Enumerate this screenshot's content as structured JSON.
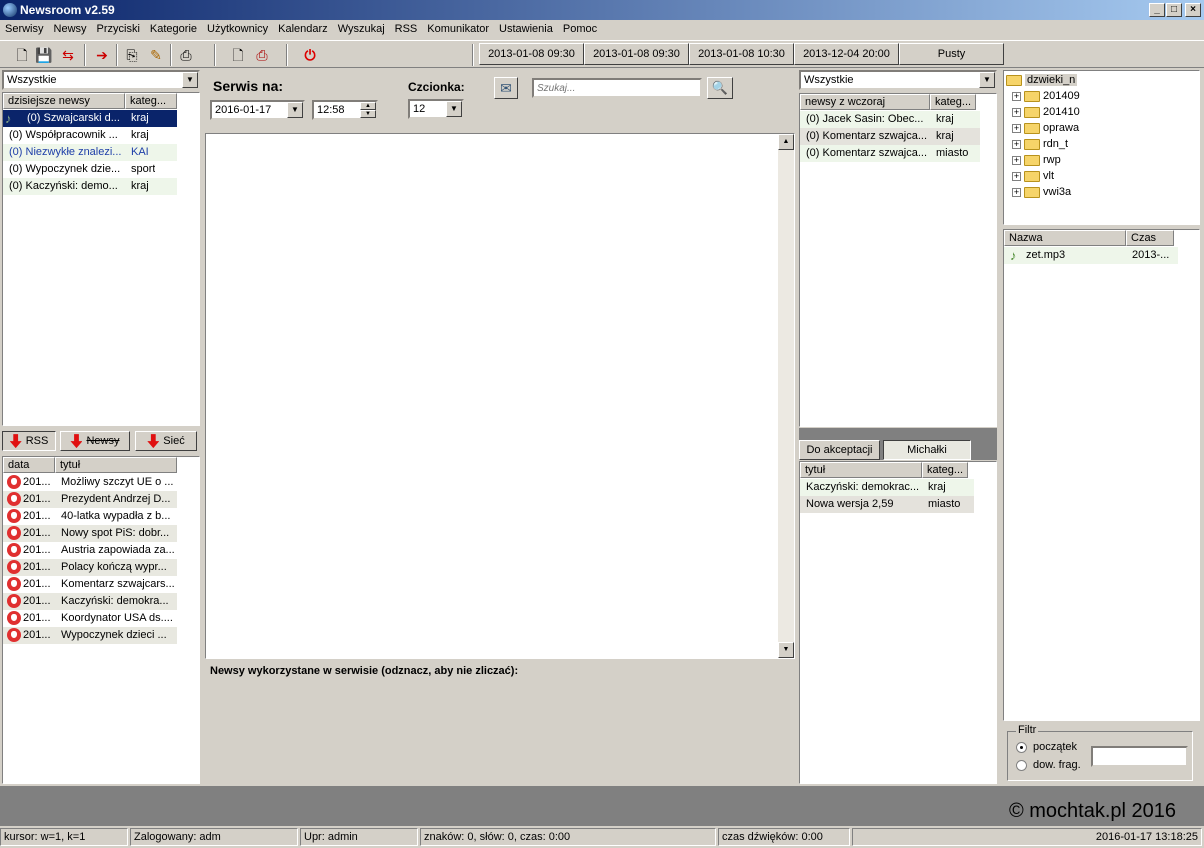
{
  "window": {
    "title": "Newsroom v2.59"
  },
  "menu": [
    "Serwisy",
    "Newsy",
    "Przyciski",
    "Kategorie",
    "Użytkownicy",
    "Kalendarz",
    "Wyszukaj",
    "RSS",
    "Komunikator",
    "Ustawienia",
    "Pomoc"
  ],
  "toolbar": {
    "icons": [
      "new-document-icon",
      "save-icon",
      "import-icon",
      "export-icon",
      "edit-icon",
      "pencil-icon",
      "print-icon",
      "new-file-icon",
      "printer-icon",
      "power-icon"
    ],
    "date_buttons": [
      "2013-01-08 09:30",
      "2013-01-08 09:30",
      "2013-01-08 10:30",
      "2013-12-04 20:00",
      "Pusty"
    ]
  },
  "left_panel": {
    "filter": "Wszystkie",
    "headers": [
      "dzisiejsze newsy",
      "kateg..."
    ],
    "rows": [
      {
        "title": "(0) Szwajcarski d...",
        "cat": "kraj"
      },
      {
        "title": "(0) Współpracownik ...",
        "cat": "kraj"
      },
      {
        "title": "(0) Niezwykłe znalezi...",
        "cat": "KAI"
      },
      {
        "title": "(0) Wypoczynek dzie...",
        "cat": "sport"
      },
      {
        "title": "(0) Kaczyński: demo...",
        "cat": "kraj"
      }
    ],
    "tabs": [
      "RSS",
      "Newsy",
      "Sieć"
    ],
    "rss_headers": [
      "data",
      "tytuł"
    ],
    "rss_rows": [
      {
        "date": "201...",
        "title": "Możliwy szczyt UE o ..."
      },
      {
        "date": "201...",
        "title": "Prezydent Andrzej D..."
      },
      {
        "date": "201...",
        "title": "40-latka wypadła z b..."
      },
      {
        "date": "201...",
        "title": "Nowy spot PiS: dobr..."
      },
      {
        "date": "201...",
        "title": "Austria zapowiada za..."
      },
      {
        "date": "201...",
        "title": "Polacy kończą wypr..."
      },
      {
        "date": "201...",
        "title": "Komentarz szwajcars..."
      },
      {
        "date": "201...",
        "title": "Kaczyński: demokra..."
      },
      {
        "date": "201...",
        "title": "Koordynator USA ds...."
      },
      {
        "date": "201...",
        "title": "Wypoczynek dzieci ..."
      }
    ]
  },
  "center": {
    "serwis_label": "Serwis na:",
    "date_value": "2016-01-17",
    "time_value": "12:58",
    "font_label": "Czcionka:",
    "font_value": "12",
    "search_placeholder": "Szukaj...",
    "footer_label": "Newsy wykorzystane w serwisie (odznacz, aby nie zliczać):"
  },
  "mid_right": {
    "filter": "Wszystkie",
    "headers": [
      "newsy z wczoraj",
      "kateg..."
    ],
    "rows": [
      {
        "title": "(0) Jacek Sasin: Obec...",
        "cat": "kraj"
      },
      {
        "title": "(0) Komentarz szwajca...",
        "cat": "kraj"
      },
      {
        "title": "(0) Komentarz szwajca...",
        "cat": "miasto"
      }
    ],
    "tabs": [
      "Do akceptacji",
      "Michałki"
    ],
    "accept_headers": [
      "tytuł",
      "kateg..."
    ],
    "accept_rows": [
      {
        "title": "Kaczyński: demokrac...",
        "cat": "kraj"
      },
      {
        "title": "Nowa wersja 2,59",
        "cat": "miasto"
      }
    ]
  },
  "right": {
    "root_folder": "dzwieki_n",
    "folders": [
      "201409",
      "201410",
      "oprawa",
      "rdn_t",
      "rwp",
      "vlt",
      "vwi3a"
    ],
    "file_headers": [
      "Nazwa",
      "Czas"
    ],
    "files": [
      {
        "name": "zet.mp3",
        "time": "2013-..."
      }
    ],
    "filter_label": "Filtr",
    "filter_options": [
      "początek",
      "dow. frag."
    ],
    "filter_selected": "początek"
  },
  "copyright": "© mochtak.pl 2016",
  "statusbar": {
    "cursor": "kursor: w=1, k=1",
    "logged": "Zalogowany: adm",
    "upr": "Upr: admin",
    "chars": "znaków: 0, słów: 0, czas: 0:00",
    "sound": "czas dźwięków: 0:00",
    "datetime": "2016-01-17 13:18:25"
  }
}
